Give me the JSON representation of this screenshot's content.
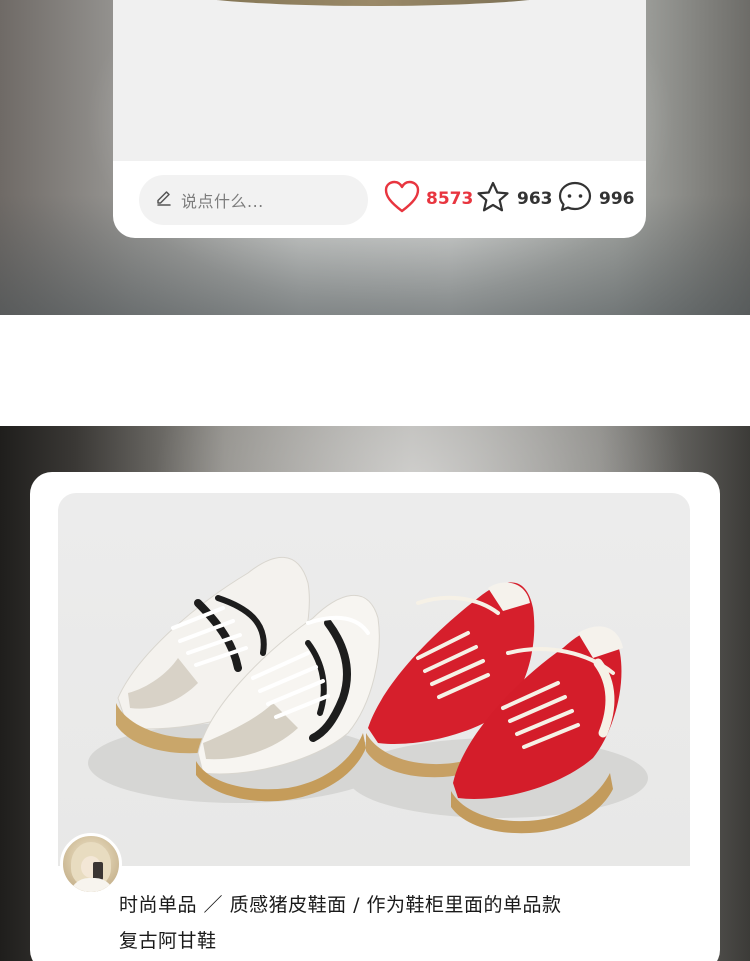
{
  "post_top": {
    "comment_placeholder": "说点什么...",
    "likes": "8573",
    "favorites": "963",
    "comments": "996",
    "like_color": "#e8353f"
  },
  "post_bottom": {
    "caption_line1": "时尚单品 ／ 质感猪皮鞋面 / 作为鞋柜里面的单品款",
    "caption_line2": "复古阿甘鞋"
  },
  "icons": {
    "comment_input": "pencil-icon",
    "like": "heart-icon",
    "favorite": "star-icon",
    "comment": "chat-bubble-icon"
  },
  "colors": {
    "accent_red": "#e8353f",
    "text_dark": "#1a1a1a"
  }
}
